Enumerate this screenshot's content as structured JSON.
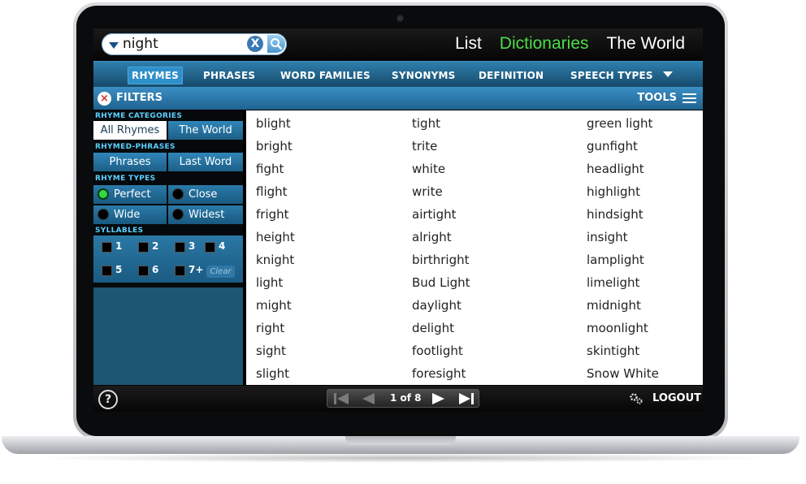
{
  "search": {
    "value": "night"
  },
  "topnav": {
    "list": "List",
    "dictionaries": "Dictionaries",
    "world": "The World"
  },
  "tabs": {
    "rhymes": "RHYMES",
    "phrases": "PHRASES",
    "word_families": "WORD FAMILIES",
    "synonyms": "SYNONYMS",
    "definition": "DEFINITION",
    "speech_types": "SPEECH TYPES"
  },
  "filterbar": {
    "filters": "FILTERS",
    "tools": "TOOLS"
  },
  "sidebar": {
    "rhyme_categories": "RHYME CATEGORIES",
    "all_rhymes": "All Rhymes",
    "the_world": "The World",
    "rhymed_phrases": "RHYMED-PHRASES",
    "phrases": "Phrases",
    "last_word": "Last Word",
    "rhyme_types": "RHYME TYPES",
    "perfect": "Perfect",
    "close": "Close",
    "wide": "Wide",
    "widest": "Widest",
    "syllables": "SYLLABLES",
    "syl": [
      "1",
      "2",
      "3",
      "4",
      "5",
      "6",
      "7+"
    ],
    "clear": "Clear"
  },
  "results": {
    "col1": [
      "blight",
      "bright",
      "fight",
      "flight",
      "fright",
      "height",
      "knight",
      "light",
      "might",
      "right",
      "sight",
      "slight"
    ],
    "col2": [
      "tight",
      "trite",
      "white",
      "write",
      "airtight",
      "alright",
      "birthright",
      "Bud Light",
      "daylight",
      "delight",
      "footlight",
      "foresight"
    ],
    "col3": [
      "green light",
      "gunfight",
      "headlight",
      "highlight",
      "hindsight",
      "insight",
      "lamplight",
      "limelight",
      "midnight",
      "moonlight",
      "skintight",
      "Snow White"
    ]
  },
  "footer": {
    "help": "?",
    "page": "1 of 8",
    "logout": "LOGOUT"
  },
  "colors": {
    "accent_green": "#4ddc4a",
    "tab_blue": "#2e7fad",
    "section_cyan": "#5ad0ff"
  }
}
